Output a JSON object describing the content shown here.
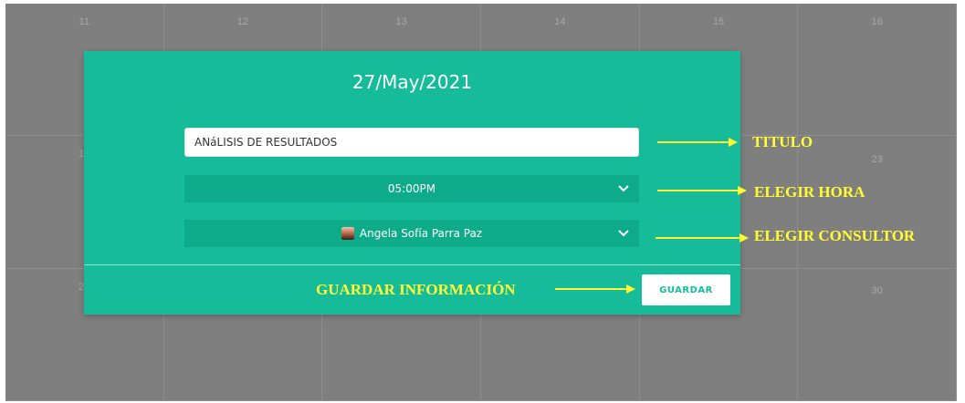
{
  "calendar": {
    "days": [
      "11",
      "12",
      "13",
      "14",
      "15",
      "16",
      "1",
      "",
      "",
      "",
      "",
      "23",
      "2",
      "",
      "",
      "",
      "",
      "30"
    ]
  },
  "modal": {
    "title": "27/May/2021",
    "title_input_value": "ANáLISIS DE RESULTADOS",
    "hour_select_value": "05:00PM",
    "consultant_select_value": "Angela Sofía Parra Paz",
    "save_label": "GUARDAR"
  },
  "annotations": {
    "titulo": "TITULO",
    "elegir_hora": "ELEGIR HORA",
    "elegir_consultor": "ELEGIR CONSULTOR",
    "guardar_info": "GUARDAR INFORMACIÓN"
  },
  "colors": {
    "modal_bg": "#16bb9a",
    "select_bg": "#0eab8a",
    "annotation": "#ffff33",
    "overlay": "#7f7f7f"
  },
  "icons": {
    "select_chevron": "chevron-down-icon",
    "consultant_avatar": "avatar-icon"
  }
}
